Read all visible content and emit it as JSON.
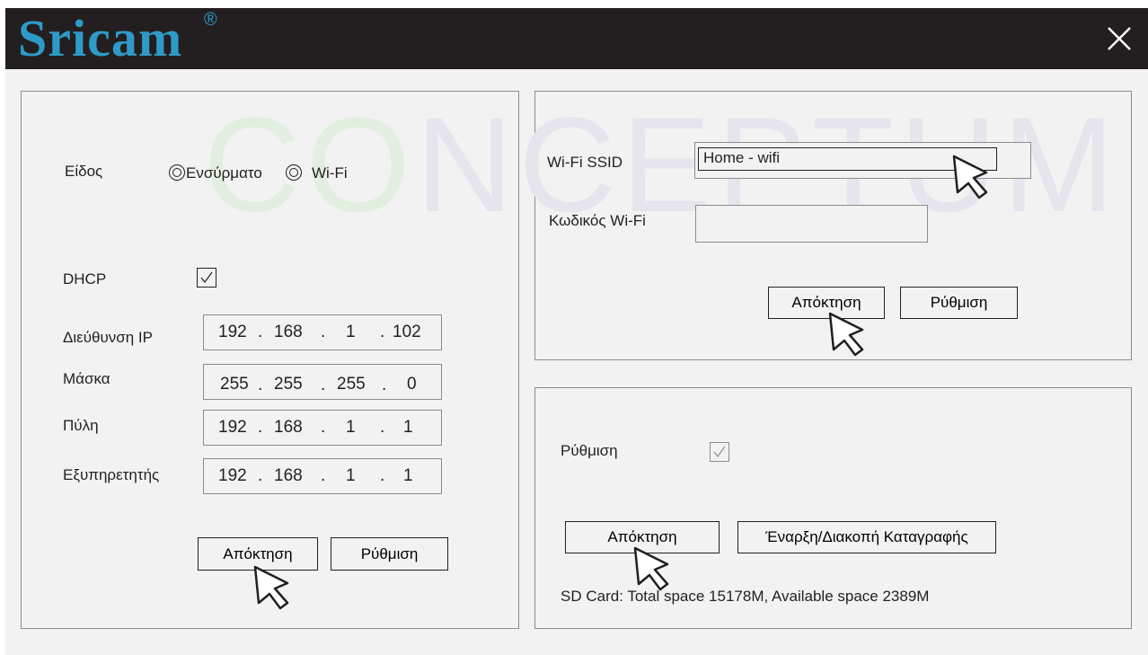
{
  "header": {
    "brand": "Sricam",
    "registered_mark": "®",
    "close_icon": "close-icon"
  },
  "watermark": "CONCEPTUM",
  "network": {
    "type_label": "Είδος",
    "type_options": [
      "Ενσύρματο",
      "Wi-Fi"
    ],
    "dhcp_label": "DHCP",
    "dhcp_checked": true,
    "fields": [
      {
        "label": "Διεύθυνση IP",
        "octets": [
          "192",
          "168",
          "1",
          "102"
        ]
      },
      {
        "label": "Μάσκα",
        "octets": [
          "255",
          "255",
          "255",
          "0"
        ]
      },
      {
        "label": "Πύλη",
        "octets": [
          "192",
          "168",
          "1",
          "1"
        ]
      },
      {
        "label": "Εξυπηρετητής",
        "octets": [
          "192",
          "168",
          "1",
          "1"
        ]
      }
    ],
    "get_button": "Απόκτηση",
    "set_button": "Ρύθμιση"
  },
  "wifi": {
    "ssid_label": "Wi-Fi SSID",
    "ssid_value": "Home - wifi",
    "password_label": "Κωδικός Wi-Fi",
    "password_value": "",
    "get_button": "Απόκτηση",
    "set_button": "Ρύθμιση"
  },
  "record": {
    "setting_label": "Ρύθμιση",
    "setting_checked": true,
    "get_button": "Απόκτηση",
    "record_button": "Έναρξη/Διακοπή Καταγραφής",
    "sd_status": "SD Card: Total space 15178M, Available space 2389M"
  },
  "colors": {
    "titlebar": "#231f20",
    "brand": "#2e9ac8",
    "background": "#f2f2f2",
    "border": "#8c8c8c"
  }
}
